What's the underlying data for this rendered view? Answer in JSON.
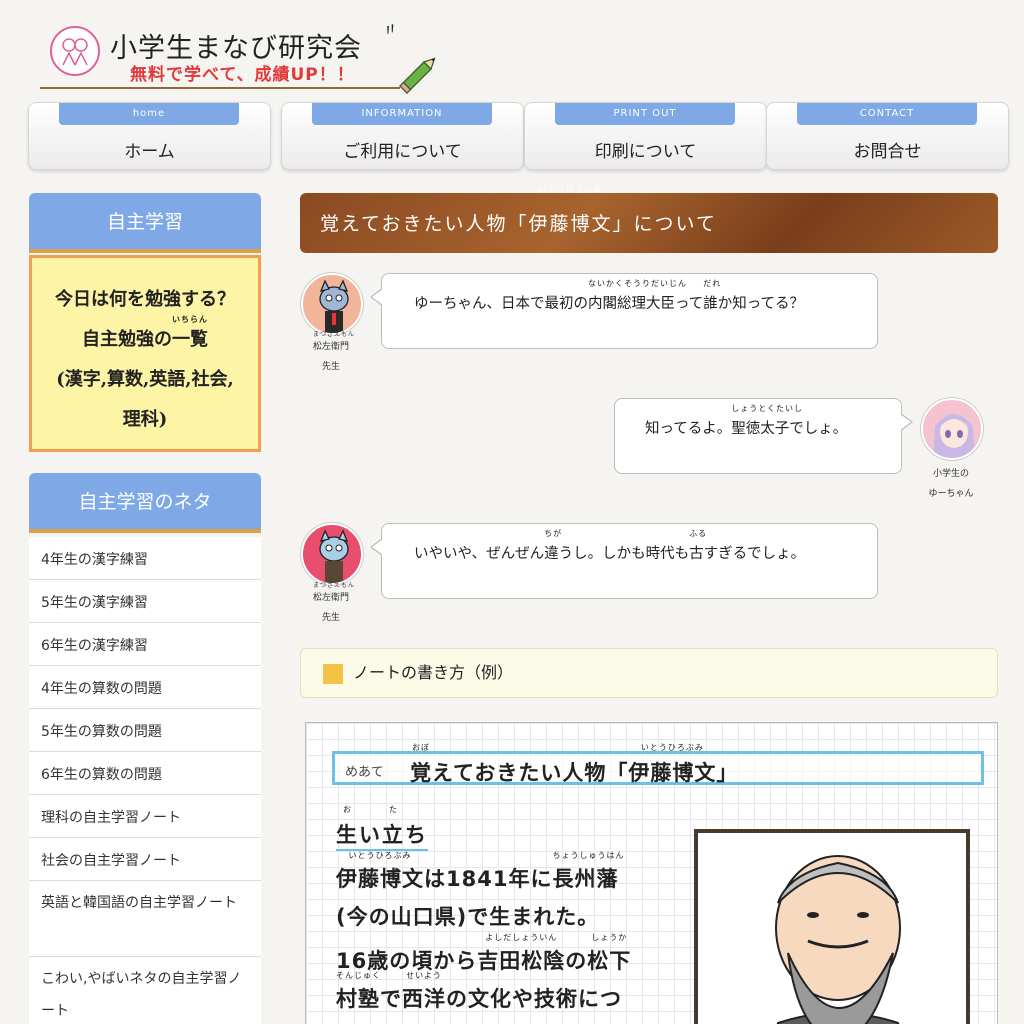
{
  "header": {
    "title": "小学生まなび研究会",
    "tagline": "無料で学べて、成績UP！！"
  },
  "nav": [
    {
      "tag": "home",
      "label": "ホーム"
    },
    {
      "tag": "INFORMATION",
      "label": "ご利用について"
    },
    {
      "tag": "PRINT OUT",
      "label": "印刷について"
    },
    {
      "tag": "CONTACT",
      "label": "お問合せ"
    }
  ],
  "sidebar": {
    "section1_title": "自主学習",
    "box_line1": "今日は何を勉強する？",
    "box_line2_a": "自主勉強の",
    "box_line2_b": "一覧",
    "box_line2_ruby": "いちらん",
    "box_line3": "(漢字,算数,英語,社会,",
    "box_line4": "理科)",
    "section2_title": "自主学習のネタ",
    "items": [
      {
        "label": "4年生の漢字練習"
      },
      {
        "label": "5年生の漢字練習"
      },
      {
        "label": "6年生の漢字練習"
      },
      {
        "label": "4年生の算数の問題"
      },
      {
        "label": "5年生の算数の問題"
      },
      {
        "label": "6年生の算数の問題"
      },
      {
        "label": "理科の自主学習ノート"
      },
      {
        "label": "社会の自主学習ノート"
      },
      {
        "label": "英語と韓国語の自主学習ノート"
      },
      {
        "label": "こわい,やばいネタの自主学習ノート"
      }
    ]
  },
  "article": {
    "title_a": "覚えておきたい人物「",
    "title_name": "伊藤博文",
    "title_name_ruby": "いとうひろぶみ",
    "title_b": "」について"
  },
  "dialog": [
    {
      "speaker_name": "松左衛門",
      "speaker_ruby": "まつざえもん",
      "speaker_role": "先生",
      "text_a": "ゆーちゃん、日本で最初の",
      "text_ruby_word": "内閣総理大臣",
      "text_ruby": "ないかくそうりだいじん",
      "text_b": "って",
      "text_ruby_word2": "誰",
      "text_ruby2": "だれ",
      "text_c": "か知ってる？"
    },
    {
      "speaker_line1": "小学生の",
      "speaker_line2": "ゆーちゃん",
      "text_a": "知ってるよ。",
      "text_ruby_word": "聖徳太子",
      "text_ruby": "しょうとくたいし",
      "text_b": "でしょ。"
    },
    {
      "speaker_name": "松左衛門",
      "speaker_ruby": "まつざえもん",
      "speaker_role": "先生",
      "text_a": "いやいや、ぜんぜん",
      "text_ruby_word": "違",
      "text_ruby": "ちが",
      "text_b": "うし。しかも時代も",
      "text_ruby_word2": "古",
      "text_ruby2": "ふる",
      "text_c": "すぎるでしょ。"
    }
  ],
  "note": {
    "heading": "ノートの書き方（例）",
    "meate_label": "めあて",
    "meate_a": "",
    "meate_word1": "覚",
    "meate_ruby1": "おぼ",
    "meate_b": "えておきたい人物「",
    "meate_word2": "伊藤博文",
    "meate_ruby2": "いとうひろぶみ",
    "meate_c": "」",
    "sub_word": "生",
    "sub_ruby": "お",
    "sub_mid": "い",
    "sub_word2": "立",
    "sub_ruby2": "た",
    "sub_end": "ち",
    "line1_word": "伊藤博文",
    "line1_ruby": "いとうひろぶみ",
    "line1_a": "は1841年に",
    "line1_word2": "長州藩",
    "line1_ruby2": "ちょうしゅうはん",
    "line2": "(今の山口県)で生まれた。",
    "line3_a": "16歳の頃から",
    "line3_word": "吉田松陰",
    "line3_ruby": "よしだしょういん",
    "line3_b": "の",
    "line3_word2": "松下",
    "line3_ruby2": "しょうか",
    "line4_word": "村塾",
    "line4_ruby": "そんじゅく",
    "line4_a": "で",
    "line4_word2": "西洋",
    "line4_ruby2": "せいよう",
    "line4_b": "の文化や技術につ"
  }
}
